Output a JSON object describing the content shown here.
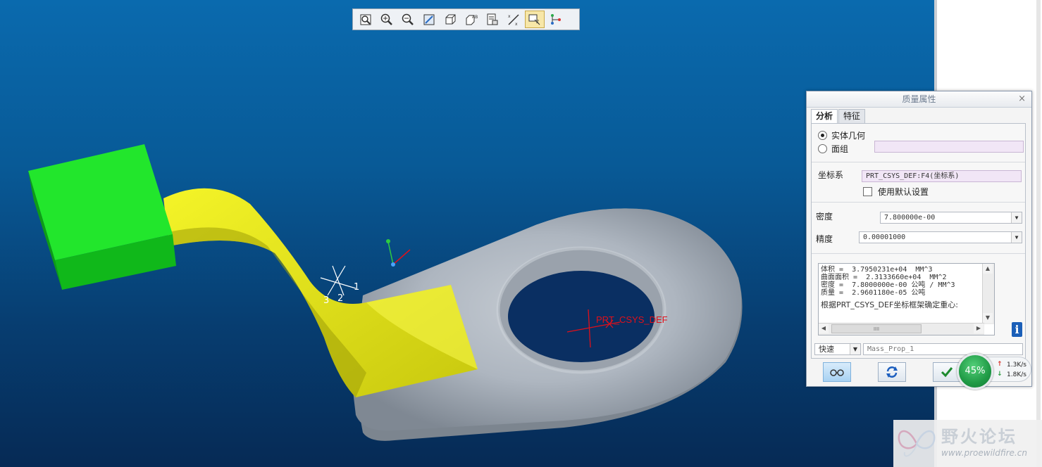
{
  "dialog": {
    "title": "质量属性",
    "close_symbol": "×",
    "tabs": [
      {
        "label": "分析"
      },
      {
        "label": "特征"
      }
    ],
    "solid_geometry_label": "实体几何",
    "quilt_label": "面组",
    "coordinate_label": "坐标系",
    "coordinate_value": "PRT_CSYS_DEF:F4(坐标系)",
    "use_default_label": "使用默认设置",
    "density_label": "密度",
    "density_value": "7.800000e-00",
    "precision_label": "精度",
    "precision_value": "0.00001000",
    "results": [
      "体积 =  3.7950231e+04  MM^3",
      "曲面面积 =  2.3133660e+04  MM^2",
      "密度 =  7.8000000e-00 公吨 / MM^3",
      "质量 =  2.9601180e-05 公吨"
    ],
    "results_note": "根据PRT_CSYS_DEF坐标框架确定重心:",
    "scroll_thumb_label": "IIII",
    "mode_value": "快速",
    "name_value": "Mass_Prop_1",
    "info_label": "i"
  },
  "netmeter": {
    "percent": "45%",
    "up_rate": "1.3K/s",
    "down_rate": "1.8K/s",
    "up_arrow": "↑",
    "down_arrow": "↓",
    "colors": {
      "up": "#d9342b",
      "down": "#2a9a3d"
    }
  },
  "viewport": {
    "csys_label": "PRT_CSYS_DEF",
    "triad_labels": [
      "1",
      "2",
      "3"
    ],
    "colors": {
      "block": "#1fe02a",
      "strip": "#ecec14",
      "bracket": "#a9b2bd",
      "csys": "#e0101a"
    }
  },
  "toolbar": {
    "icons": [
      "refit-icon",
      "zoom-in-icon",
      "zoom-out-icon",
      "repaint-icon",
      "display-style-icon",
      "saved-views-icon",
      "layers-icon",
      "datum-display-icon",
      "spin-center-icon",
      "orient-mode-icon"
    ],
    "active_index": 8
  },
  "watermark": {
    "title": "野火论坛",
    "url": "www.proewildfire.cn"
  }
}
